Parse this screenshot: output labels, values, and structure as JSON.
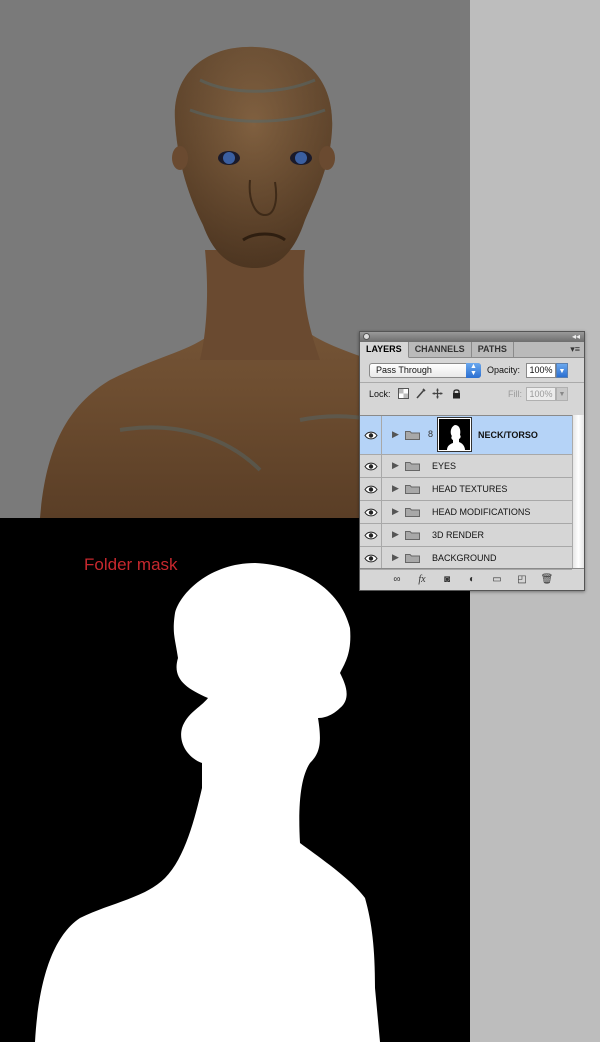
{
  "mask_caption": "Folder mask",
  "panel": {
    "tabs": [
      "LAYERS",
      "CHANNELS",
      "PATHS"
    ],
    "blend_mode": "Pass Through",
    "opacity_label": "Opacity:",
    "opacity_value": "100%",
    "lock_label": "Lock:",
    "fill_label": "Fill:",
    "fill_value": "100%",
    "layers": [
      {
        "name": "NECK/TORSO",
        "selected": true
      },
      {
        "name": "EYES"
      },
      {
        "name": "HEAD TEXTURES"
      },
      {
        "name": "HEAD MODIFICATIONS"
      },
      {
        "name": "3D RENDER"
      },
      {
        "name": "BACKGROUND"
      }
    ],
    "footer_icons": [
      "link-layers-icon",
      "fx-icon",
      "add-mask-icon",
      "adjustment-layer-icon",
      "new-group-icon",
      "new-layer-icon",
      "trash-icon"
    ]
  },
  "colors": {
    "render_bg": "#7a7a7a",
    "mask_bg": "#000000",
    "caption": "#c7282e",
    "selection": "#b5d3f7"
  }
}
